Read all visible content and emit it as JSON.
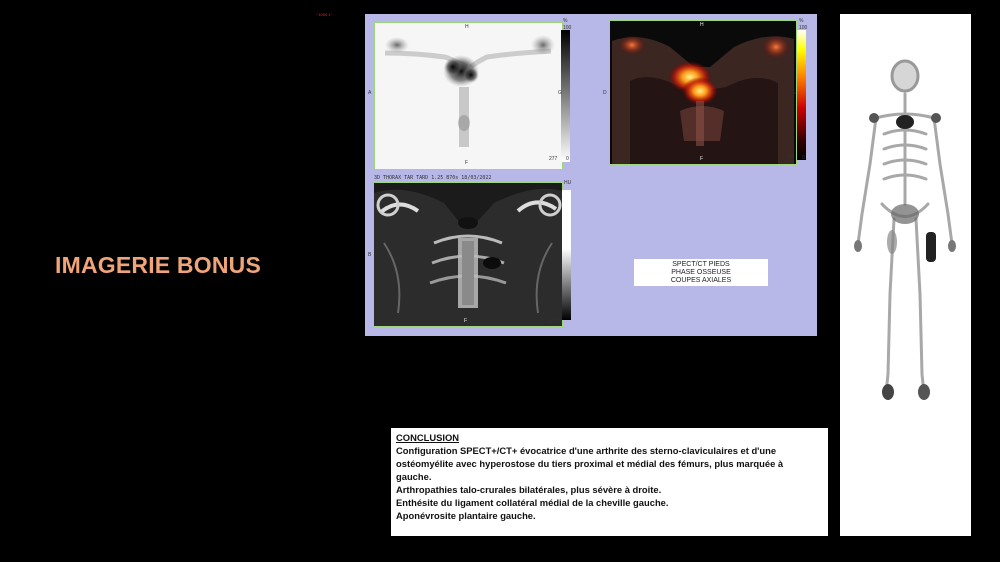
{
  "slide": {
    "title": "IMAGERIE BONUS",
    "accent_color": "#f0a47a"
  },
  "viewer": {
    "top_info": "~1000 1~",
    "panel_header_ct": "3D THORAX TAR TARD 1.25 B70s 18/03/2022",
    "scale_max_pct": "100",
    "scale_min": "0",
    "scale_top_unit": "%",
    "ct_unit": "HU",
    "scale_value": "277",
    "orient_h": "H",
    "orient_f": "F",
    "orient_d": "D",
    "orient_g": "G",
    "orient_a": "A",
    "orient_b": "B",
    "info_box": {
      "line1": "SPECT/CT PIEDS",
      "line2": "PHASE OSSEUSE",
      "line3": "COUPES AXIALES"
    }
  },
  "conclusion": {
    "heading": "CONCLUSION",
    "line1": "Configuration SPECT+/CT+ évocatrice d'une arthrite des sterno-claviculaires et d'une",
    "line2": "ostéomyélite avec hyperostose du tiers proximal et médial des fémurs, plus marquée à",
    "line3": "gauche.",
    "line4": "Arthropathies talo-crurales bilatérales, plus sévère à droite.",
    "line5": "Enthésite du ligament collatéral médial de la cheville gauche.",
    "line6": "Aponévrosite plantaire gauche."
  }
}
